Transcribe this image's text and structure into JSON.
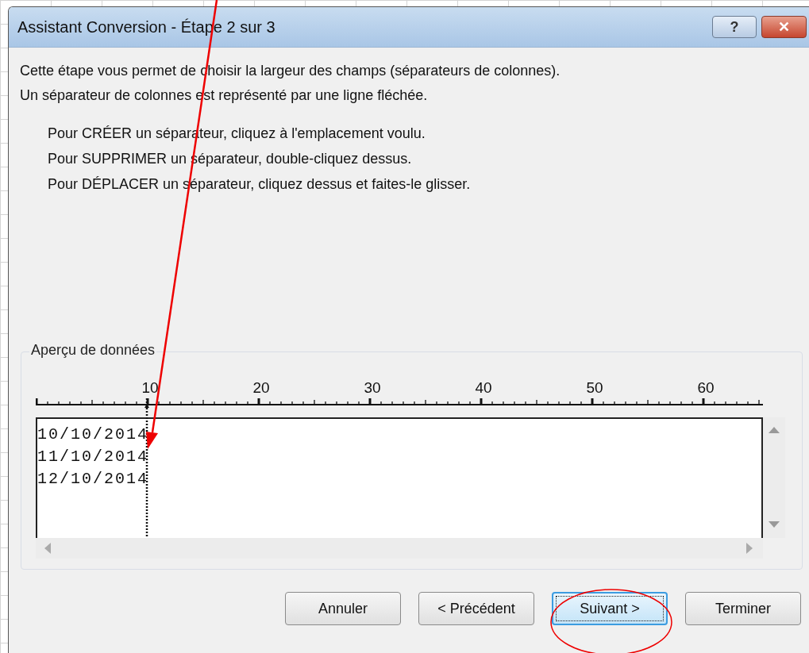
{
  "window": {
    "title": "Assistant Conversion - Étape 2 sur 3",
    "controls": [
      {
        "kind": "help",
        "glyph": "?"
      },
      {
        "kind": "close",
        "glyph": "✕"
      }
    ]
  },
  "intro": [
    "Cette étape vous permet de choisir la largeur des champs (séparateurs de colonnes).",
    "Un séparateur de colonnes est représenté par une ligne fléchée."
  ],
  "instructions": [
    "Pour CRÉER un séparateur, cliquez à l'emplacement voulu.",
    "Pour SUPPRIMER un séparateur, double-cliquez dessus.",
    "Pour DÉPLACER un séparateur, cliquez dessus et faites-le glisser."
  ],
  "preview": {
    "title": "Aperçu de données",
    "ruler_labels": [
      "10",
      "20",
      "30",
      "40",
      "50",
      "60"
    ],
    "rows": [
      "10/10/2014",
      "11/10/2014",
      "12/10/2014"
    ]
  },
  "buttons": [
    {
      "label": "Annuler",
      "focused": false
    },
    {
      "label": "< Précédent",
      "focused": false
    },
    {
      "label": "Suivant >",
      "focused": true
    },
    {
      "label": "Terminer",
      "focused": false
    }
  ]
}
